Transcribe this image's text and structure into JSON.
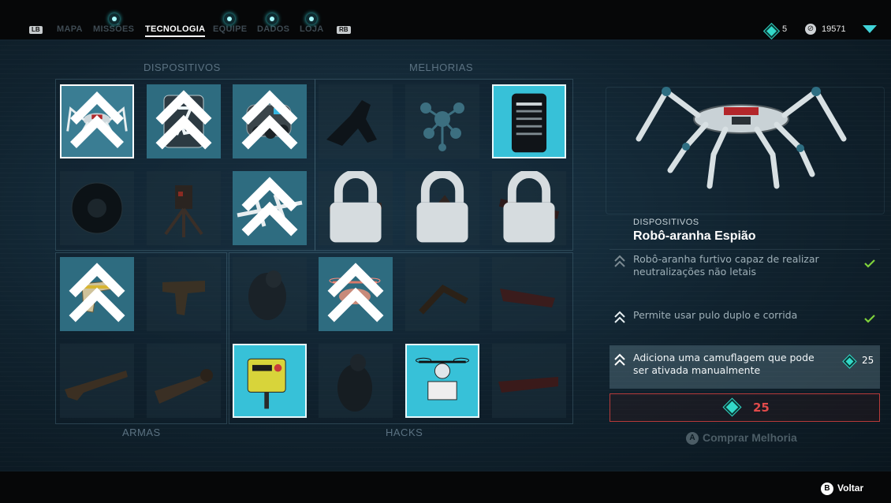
{
  "nav": {
    "lb": "LB",
    "rb": "RB",
    "tabs": [
      "MAPA",
      "MISSÕES",
      "TECNOLOGIA",
      "EQUIPE",
      "DADOS",
      "LOJA"
    ],
    "active_tab": "TECNOLOGIA"
  },
  "currency": {
    "tech_points": "5",
    "eto": "19571"
  },
  "sections": {
    "dispositivos": "DISPOSITIVOS",
    "melhorias": "MELHORIAS",
    "armas": "ARMAS",
    "hacks": "HACKS"
  },
  "detail": {
    "category": "DISPOSITIVOS",
    "name": "Robô-aranha Espião",
    "upgrades": [
      {
        "text": "Robô-aranha furtivo capaz de realizar neutralizações não letais",
        "owned": true
      },
      {
        "text": "Permite usar pulo duplo e corrida",
        "owned": true
      },
      {
        "text": "Adiciona uma camuflagem que pode ser ativada manualmente",
        "owned": false,
        "cost": "25"
      }
    ],
    "total_cost": "25",
    "buy_button": "A",
    "buy_label": "Comprar Melhoria"
  },
  "footer": {
    "back_button": "B",
    "back_label": "Voltar"
  },
  "colors": {
    "accent": "#33d9c8",
    "selected_tile": "#37c1d8",
    "cost_border": "#b83a3a",
    "check": "#7fd23b"
  }
}
